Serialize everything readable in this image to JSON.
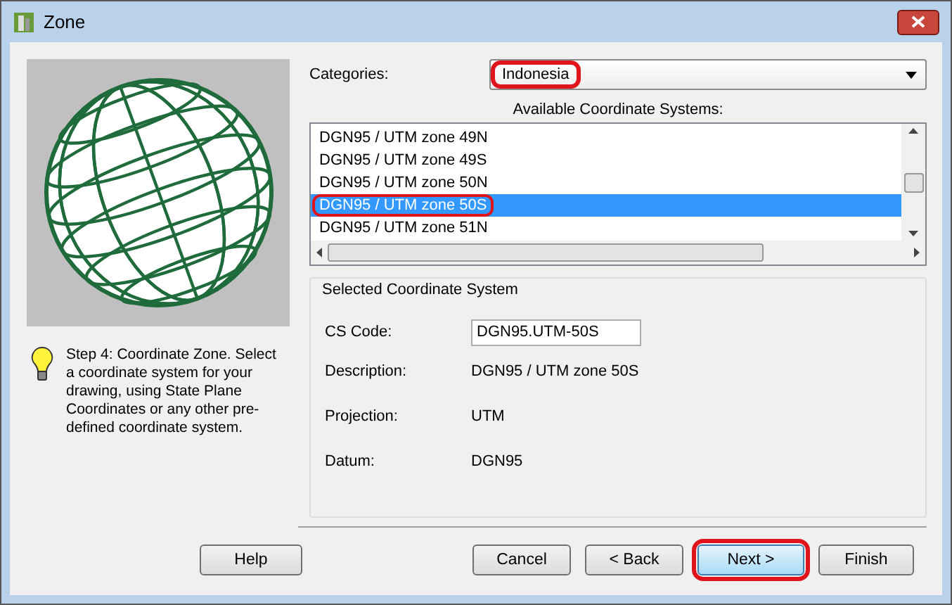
{
  "window": {
    "title": "Zone"
  },
  "categories": {
    "label": "Categories:",
    "value": "Indonesia",
    "highlighted": true
  },
  "available": {
    "label": "Available Coordinate Systems:",
    "items": [
      {
        "label": "DGN95 / UTM zone 49N",
        "selected": false,
        "highlighted": false
      },
      {
        "label": "DGN95 / UTM zone 49S",
        "selected": false,
        "highlighted": false
      },
      {
        "label": "DGN95 / UTM zone 50N",
        "selected": false,
        "highlighted": false
      },
      {
        "label": "DGN95 / UTM zone 50S",
        "selected": true,
        "highlighted": true
      },
      {
        "label": "DGN95 / UTM zone 51N",
        "selected": false,
        "highlighted": false
      }
    ]
  },
  "selected_system": {
    "title": "Selected Coordinate System",
    "fields": [
      {
        "kind": "input",
        "label": "CS Code:",
        "value": "DGN95.UTM-50S"
      },
      {
        "kind": "text",
        "label": "Description:",
        "value": "DGN95 / UTM zone 50S"
      },
      {
        "kind": "text",
        "label": "Projection:",
        "value": "UTM"
      },
      {
        "kind": "text",
        "label": "Datum:",
        "value": "DGN95"
      }
    ]
  },
  "step": {
    "text": "Step 4:  Coordinate Zone. Select a coordinate system for your drawing, using State Plane Coordinates or any other pre-defined coordinate system."
  },
  "buttons": [
    {
      "label": "Help",
      "highlighted": false,
      "default": false
    },
    {
      "label": "Cancel",
      "highlighted": false,
      "default": false
    },
    {
      "label": "< Back",
      "highlighted": false,
      "default": false
    },
    {
      "label": "Next >",
      "highlighted": true,
      "default": true
    },
    {
      "label": "Finish",
      "highlighted": false,
      "default": false
    }
  ]
}
